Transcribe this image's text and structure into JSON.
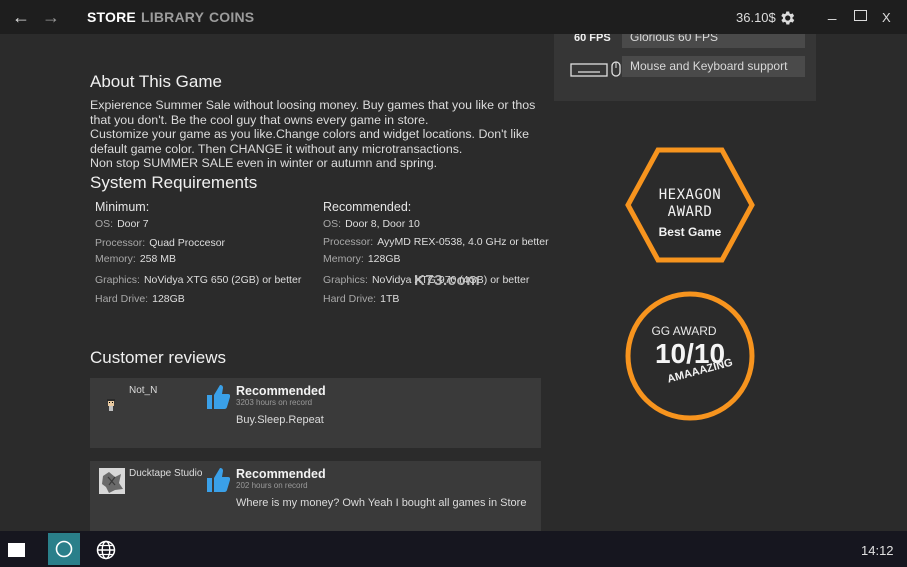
{
  "nav": {
    "back_icon": "arrow-left-icon",
    "forward_icon": "arrow-right-icon",
    "tabs": [
      {
        "label": "STORE",
        "active": true
      },
      {
        "label": "LIBRARY",
        "active": false
      },
      {
        "label": "COINS",
        "active": false
      }
    ],
    "balance": "36.10$",
    "settings_icon": "gear-icon",
    "minimize": "_",
    "close": "X"
  },
  "features": {
    "fps_key": "60 FPS",
    "fps_value": "Glorious 60 FPS",
    "input_icon": "keyboard-mouse-icon",
    "input_value": "Mouse and Keyboard support"
  },
  "about": {
    "title": "About This Game",
    "lines": [
      "Expierence Summer Sale without loosing money. Buy games that you like or thos that you don't. Be the cool guy that owns every game in store.",
      "Customize your game as you like.Change colors and widget locations. Don't like default game color. Then CHANGE it without any microtransactions.",
      "Non stop SUMMER SALE even in winter or autumn and spring."
    ]
  },
  "requirements": {
    "title": "System Requirements",
    "minimum": {
      "label": "Minimum:",
      "rows": [
        {
          "k": "OS:",
          "v": "Door 7"
        },
        {
          "k": "Processor:",
          "v": "Quad Proccesor"
        },
        {
          "k": "Memory:",
          "v": "258 MB"
        },
        {
          "k": "Graphics:",
          "v": "NoVidya XTG 650 (2GB) or better"
        },
        {
          "k": "Hard Drive:",
          "v": "128GB"
        }
      ]
    },
    "recommended": {
      "label": "Recommended:",
      "rows": [
        {
          "k": "OS:",
          "v": "Door 8, Door 10"
        },
        {
          "k": "Processor:",
          "v": "AyyMD REX-0538, 4.0 GHz or better"
        },
        {
          "k": "Memory:",
          "v": "128GB"
        },
        {
          "k": "Graphics:",
          "v": "NoVidya XTG 970 (4GB) or better"
        },
        {
          "k": "Hard Drive:",
          "v": "1TB"
        }
      ]
    }
  },
  "reviews": {
    "title": "Customer reviews",
    "items": [
      {
        "user": "Not_N",
        "verdict": "Recommended",
        "hours": "3203 hours on record",
        "text": "Buy.Sleep.Repeat"
      },
      {
        "user": "Ducktape Studio",
        "verdict": "Recommended",
        "hours": "202 hours on record",
        "text": "Where is my money? Owh Yeah I bought all games in Store"
      }
    ]
  },
  "awards": {
    "hexagon": {
      "line1": "HEXAGON",
      "line2": "AWARD",
      "line3": "Best Game"
    },
    "gg": {
      "title": "GG AWARD",
      "score": "10/10",
      "caption": "AMAAAZING"
    },
    "accent": "#f7941e"
  },
  "watermark": "K73.com",
  "taskbar": {
    "start_icon": "start-square-icon",
    "search_icon": "circle-search-icon",
    "browser_icon": "globe-icon",
    "clock": "14:12"
  },
  "colors": {
    "topbar": "#1e1e1e",
    "background": "#2b2b2b",
    "card": "#3a3a3a",
    "taskbar": "#16161f",
    "active_taskbar": "#2a7f8a"
  }
}
